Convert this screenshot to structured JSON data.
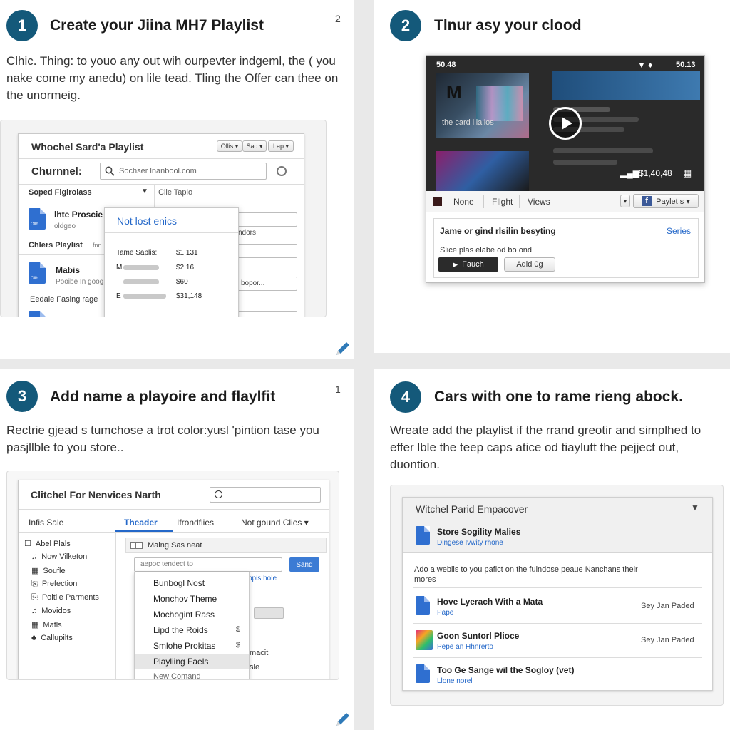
{
  "steps": [
    {
      "number": "1",
      "title": "Create your Jiina MH7 Playlist",
      "page": "2",
      "text": "Clhic. Thing: to youo any out wih ourpevter indgeml, the ( you nake come my anedu) on lile tead. Tling the Offer can thee on the unormeig.",
      "window": {
        "title": "Whochel Sard'a Playlist",
        "toolbar_buttons": [
          "Ollis ▾",
          "Sad ▾",
          "Lap ▾"
        ],
        "channel_label": "Churnnel:",
        "search_value": "Sochser lnanbool.com",
        "dropdown_label": "Soped Figlroiass",
        "column_label": "Clle Tapio",
        "items": [
          {
            "icon": "Ollb",
            "name": "lhte Proscie",
            "sub": "oldgeo"
          },
          {
            "icon": "Ollb",
            "name": "Mabis",
            "sub": "Pooibe In goog"
          }
        ],
        "section_label": "Chlers Playlist",
        "section_tag": "fnn",
        "footer_label": "Eedale Fasing rage",
        "field_text_1": "ndors",
        "field_text_2": "bopor...",
        "popup": {
          "header": "Not lost enics",
          "rows": [
            {
              "label": "Tame Saplis:",
              "value": "$1,131"
            },
            {
              "label": "M",
              "value": "$2,16"
            },
            {
              "label": "",
              "value": "$60"
            },
            {
              "label": "E",
              "value": "$31,148"
            }
          ]
        }
      }
    },
    {
      "number": "2",
      "title": "Tlnur asy your clood",
      "player": {
        "time_left": "50.48",
        "time_right": "50.13",
        "thumb_text": "the card lilalios",
        "thumb_letter": "M",
        "price": "$1,40,48",
        "tabs": [
          "None",
          "Fllght",
          "Views"
        ],
        "fb_label": "Paylet s ▾",
        "panel_title": "Jame or gind rlsilin besyting",
        "panel_link": "Series",
        "panel_sub": "Slice plas elabe od bo ond",
        "primary_button": "Fauch",
        "secondary_button": "Adid 0g"
      }
    },
    {
      "number": "3",
      "title": "Add name a playoire and flaylfit",
      "page": "1",
      "text": "Rectrie gjead s tumchose a trot color:yusl 'pintion tase you pasjllble to you store..",
      "window": {
        "title": "Clitchel For Nenvices Narth",
        "tabs": [
          "Infis Sale",
          "Theader",
          "Ifrondflies",
          "Not gound Clies ▾"
        ],
        "active_tab": 1,
        "sidebar": [
          "Abel Plals",
          "Now Vilketon",
          "Soufle",
          "Prefection",
          "Poltile Parments",
          "Movidos",
          "Mafls",
          "Callupilts"
        ],
        "sidebar_icons": [
          "☐",
          "♫",
          "▦",
          "⎘",
          "⎘",
          "♫",
          "▦",
          "♣"
        ],
        "checkbox_label": "Maing Sas neat",
        "input_placeholder": "aepoc tendect to",
        "input_button": "Sand",
        "link_text": "ppis hole",
        "extra_text_1": "macit",
        "extra_text_2": "sle",
        "menu": [
          {
            "label": "Bunbogl Nost",
            "mark": ""
          },
          {
            "label": "Monchov Theme",
            "mark": ""
          },
          {
            "label": "Mochogint Rass",
            "mark": ""
          },
          {
            "label": "Lipd the Roids",
            "mark": "$"
          },
          {
            "label": "Smlohe Prokitas",
            "mark": "$"
          },
          {
            "label": "Playliing Faels",
            "mark": ""
          },
          {
            "label": "New Comand",
            "mark": ""
          }
        ],
        "menu_highlight": 5
      }
    },
    {
      "number": "4",
      "title": "Cars with one to rame rieng abock.",
      "text": "Wreate add the playlist if the rrand greotir and simplhed to effer lble the teep caps atice od tiaylutt the pejject out, duontion.",
      "window": {
        "title": "Witchel Parid Empacover",
        "top_item": {
          "name": "Store Sogility Malies",
          "sub": "Dingese Ivwity rhone"
        },
        "note": "Ado a weblls to you pafict on the fuindose peaue Nanchans their mores",
        "items": [
          {
            "name": "Hove Lyerach With a Mata",
            "sub": "Pape",
            "meta": "Sey Jan Paded",
            "icon": "doc"
          },
          {
            "name": "Goon Suntorl Plioce",
            "sub": "Pepe an Hhnrerto",
            "meta": "Sey Jan Paded",
            "icon": "colorful"
          },
          {
            "name": "Too Ge Sange wil the Sogloy (vet)",
            "sub": "Llone norel",
            "meta": "",
            "icon": "doc"
          }
        ]
      }
    }
  ],
  "colors": {
    "step_badge": "#14597a",
    "link": "#2468c9",
    "accent_blue": "#2f6fd0"
  }
}
